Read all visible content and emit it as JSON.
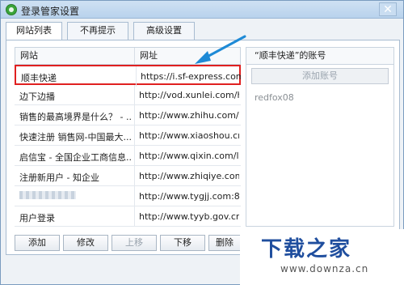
{
  "window": {
    "title": "登录管家设置",
    "close_glyph": "✕"
  },
  "tabs": [
    {
      "label": "网站列表",
      "active": true
    },
    {
      "label": "不再提示",
      "active": false
    },
    {
      "label": "高级设置",
      "active": false
    }
  ],
  "table": {
    "columns": [
      "网站",
      "网址"
    ],
    "rows": [
      {
        "site": "顺丰快递",
        "url": "https://i.sf-express.com/c...",
        "selected": true
      },
      {
        "site": "边下边播",
        "url": "http://vod.xunlei.com/ho..."
      },
      {
        "site": "销售的最高境界是什么？ - ...",
        "url": "http://www.zhihu.com/que..."
      },
      {
        "site": "快速注册 销售网-中国最大...",
        "url": "http://www.xiaoshou.cn/m..."
      },
      {
        "site": "启信宝 - 全国企业工商信息...",
        "url": "http://www.qixin.com/logi..."
      },
      {
        "site": "注册新用户 - 知企业",
        "url": "http://www.zhiqiye.com/ac..."
      },
      {
        "site": "",
        "url": "http://www.tygjj.com:8080..."
      },
      {
        "site": "用户登录",
        "url": "http://www.tyyb.gov.cn/l"
      }
    ]
  },
  "accounts": {
    "header": "“顺丰快递”的账号",
    "add_label": "添加账号",
    "items": [
      "redfox08"
    ]
  },
  "buttons": {
    "add": "添加",
    "edit": "修改",
    "up": "上移",
    "down": "下移",
    "delete": "删除"
  },
  "watermark": {
    "cn": "下载之家",
    "en": "www.downza.cn"
  },
  "colors": {
    "highlight": "#e02020",
    "arrow": "#1e8ad6",
    "brand": "#1f4e9e"
  },
  "icons": {
    "app": "app-logo-icon",
    "close": "close-icon",
    "arrow": "arrow-annotation-icon"
  }
}
